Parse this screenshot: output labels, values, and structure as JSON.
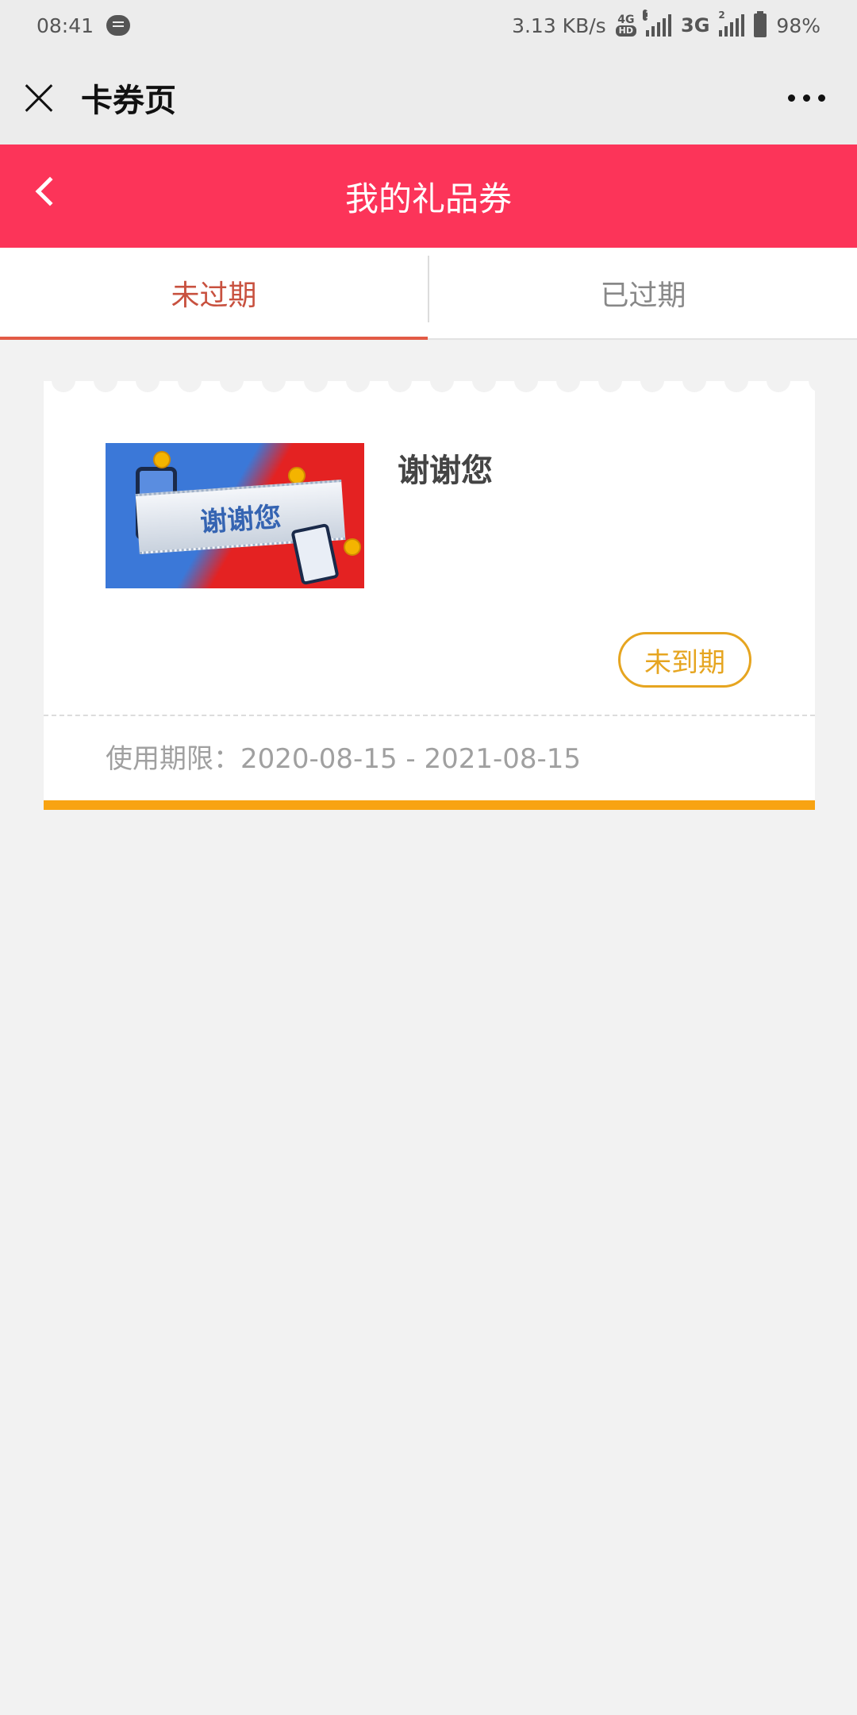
{
  "status_bar": {
    "time": "08:41",
    "speed": "3.13 KB/s",
    "network_4g": "4G",
    "network_hd": "HD",
    "sim1": "1",
    "network_3g": "3G",
    "sim2": "2",
    "battery": "98%"
  },
  "title_bar": {
    "title": "卡券页"
  },
  "header": {
    "title": "我的礼品券"
  },
  "tabs": [
    {
      "label": "未过期",
      "active": true
    },
    {
      "label": "已过期",
      "active": false
    }
  ],
  "coupon": {
    "image_text": "谢谢您",
    "name": "谢谢您",
    "status": "未到期",
    "validity": "使用期限：2020-08-15 - 2021-08-15"
  },
  "colors": {
    "header": "#fc3459",
    "active_tab": "#c8513f",
    "status": "#e6a520",
    "coupon_bar": "#f8a312"
  }
}
